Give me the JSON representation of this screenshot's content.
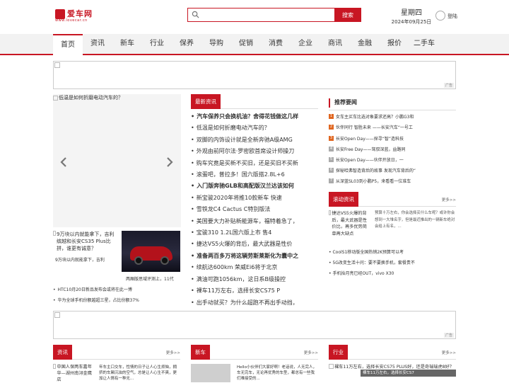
{
  "header": {
    "logo_text": "爱车网",
    "logo_sub": "www.lovecar.cn",
    "search_placeholder": "",
    "search_button": "搜索",
    "weekday": "星期四",
    "date": "2024年09月25日",
    "login": "登陆"
  },
  "nav": [
    "首页",
    "资讯",
    "新车",
    "行业",
    "保养",
    "导购",
    "促销",
    "消费",
    "企业",
    "商讯",
    "金融",
    "报价",
    "二手车"
  ],
  "ad_label": "广告",
  "slider": {
    "caption": "低温是如何折磨电动汽车的？"
  },
  "thumbs": {
    "left_caption": "9万块以内就能拿下，吉利缤越和长安CS35 Plus比拼，谁更有诚意？",
    "left_sub": "9万块以内就能拿下，吉利",
    "right_caption": "两厢版思域评测上，11代"
  },
  "bottom_links": [
    "HTC10月20日新品发布会或将在此一博",
    "华为全球手机份额越超三星，占比份额37%"
  ],
  "news": {
    "title": "最新资讯",
    "items": [
      {
        "text": "汽车保养只会换机油？舍得花钱做这几样",
        "bold": true
      },
      {
        "text": "低温是如何折磨电动汽车的？",
        "bold": false
      },
      {
        "text": "双脚的内饰设计就是全新奔驰A级AMG",
        "bold": false
      },
      {
        "text": "外观由前阿尔法·罗密欧首席设计师操刀",
        "bold": false
      },
      {
        "text": "购车究竟是买新不买旧，还是买旧不买新",
        "bold": false
      },
      {
        "text": "滚蛋吧，普拉多！国六版搭2.8L+6",
        "bold": false
      },
      {
        "text": "入门版奔驰GLB和高配版汉兰达该如何",
        "bold": true
      },
      {
        "text": "新宝骏2020年将推10款新车 快速",
        "bold": false
      },
      {
        "text": "雪铁龙C4 Cactus C特别版法",
        "bold": false
      },
      {
        "text": "美国要大力补贴新能源车，福特着急了，",
        "bold": false
      },
      {
        "text": "宝骏310 1.2L国六版上市 售4",
        "bold": false
      },
      {
        "text": "捷达VS5火爆的背后，最大武器是性价",
        "bold": false
      },
      {
        "text": "准备两百多万将这辆劳斯莱斯化为囊中之",
        "bold": true
      },
      {
        "text": "续航达600km 荣威Ei6将于北京",
        "bold": false
      },
      {
        "text": "满油可跑1056km，这日系B级操控",
        "bold": false
      },
      {
        "text": "裸车11万左右，选择长安CS75 P",
        "bold": false
      },
      {
        "text": "出手动就买？为什么超跑不再出手动挡，",
        "bold": false
      }
    ]
  },
  "hot": {
    "title": "推荐要闻",
    "items": [
      {
        "n": "1",
        "text": "女车主买车比选对象要求还高？小鹏G3和"
      },
      {
        "n": "2",
        "text": "伙伴同行 智胜未来 ——长安汽车“一号工"
      },
      {
        "n": "3",
        "text": "长安Open Day——探寻“智”造科技"
      },
      {
        "n": "4",
        "text": "长安Free Day——驾驭深蓝，益路同"
      },
      {
        "n": "5",
        "text": "长安Open Day——伙伴开放日，一"
      },
      {
        "n": "6",
        "text": "探秘哈弗智造背后的故事 发现汽车背后的“"
      },
      {
        "n": "7",
        "text": "从深蓝SL03到小鹏P5，来看看一位准车"
      }
    ]
  },
  "roll": {
    "title": "滚动资讯",
    "more": "更多>>",
    "img_caption": "捷达VS5火爆的背后，最大武器是性价比，再多优势简单再大缺点",
    "desc": "预算十万左右，你会选择买什么车呢？或许你会想到一大堆名字，但是最近推出的一辆新车绝对会给上有名，…",
    "items": [
      "CoolS1移动版全国热销2K预算可以考",
      "5G改变生活十问：要不要换手机，套餐贵不",
      "手机抬月亮已经OUT，vivo X30"
    ]
  },
  "bottom_sections": [
    {
      "title": "资讯",
      "more": "更多>>",
      "img_caption": "中国人保两车嘉年华—湖州南浔金鹰店",
      "text": "年车主口交车，性情的日子让人心生烦恼，拥挤的车厢沉浊的空气，总是让人心生不爽，更加让人情有一种无..."
    },
    {
      "title": "新车",
      "more": "更多>>",
      "img_caption": "",
      "text": "Hello小伙伴们大家好啊！老话说，人无完人，车无完车，无论再优秀的车型，都总有一些我们难接受的..."
    },
    {
      "title": "行业",
      "more": "更多>>",
      "img_caption": "裸车11万左右，选择长安CS75 PLUS好，还是奇瑞瑞虎8好？",
      "text": "裸车11万左右，选择长安CS7"
    }
  ]
}
